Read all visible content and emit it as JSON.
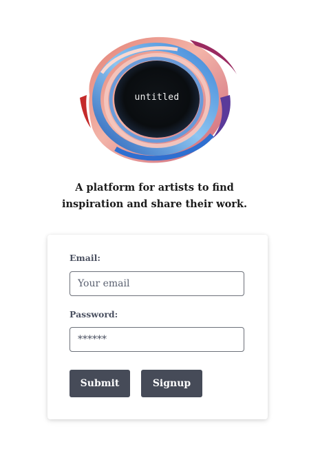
{
  "brand": {
    "logo_text": "untitled",
    "logo_icon": "paint-swirl-icon"
  },
  "tagline": {
    "line1": "A platform for artists to find",
    "line2": "inspiration and share their work."
  },
  "login_form": {
    "email_label": "Email:",
    "email_placeholder": "Your email",
    "email_value": "",
    "password_label": "Password:",
    "password_value": "******",
    "submit_label": "Submit",
    "signup_label": "Signup"
  },
  "colors": {
    "button_bg": "#464b58",
    "label_text": "#4a5060"
  }
}
